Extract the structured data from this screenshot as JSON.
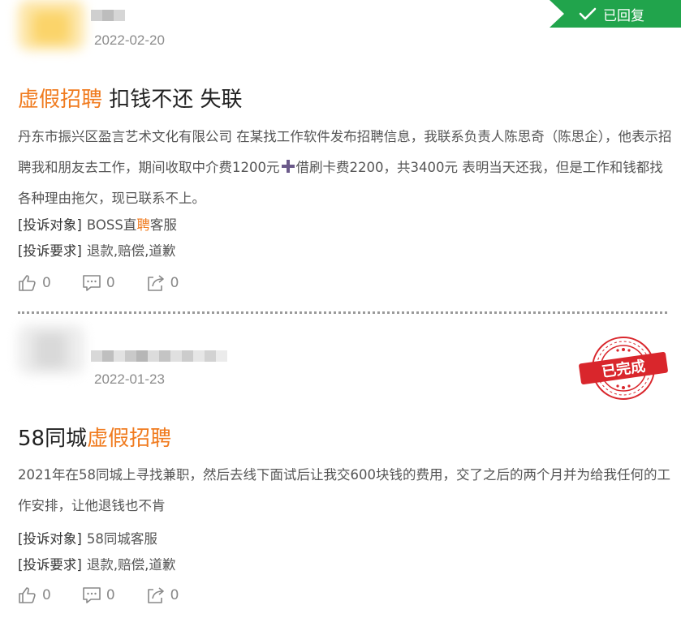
{
  "complaints": [
    {
      "date": "2022-02-20",
      "status_badge": "已回复",
      "title_highlight": "虚假招聘",
      "title_rest": " 扣钱不还 失联",
      "desc_part1": "丹东市振兴区盈言艺术文化有限公司 在某找工作软件发布招聘信息，我联系负责人陈思奇（陈思企），他表示招聘我和朋友去工作，期间收取中介费1200元",
      "desc_part2": "借刷卡费2200，共3400元 表明当天还我，但是工作和钱都找各种理由拖欠，现已联系不上。",
      "target_label": "[投诉对象]",
      "target_pre": "BOSS直",
      "target_hl": "聘",
      "target_post": "客服",
      "demand_label": "[投诉要求]",
      "demand_value": "退款,赔偿,道歉",
      "likes": "0",
      "comments": "0",
      "shares": "0"
    },
    {
      "date": "2022-01-23",
      "status_stamp": "已完成",
      "title_prefix": "58同城",
      "title_highlight": "虚假招聘",
      "desc": "2021年在58同城上寻找兼职，然后去线下面试后让我交600块钱的费用，交了之后的两个月并为给我任何的工作安排，让他退钱也不肯",
      "target_label": "[投诉对象]",
      "target_value": "58同城客服",
      "demand_label": "[投诉要求]",
      "demand_value": "退款,赔偿,道歉",
      "likes": "0",
      "comments": "0",
      "shares": "0"
    }
  ],
  "colors": {
    "highlight": "#f07b1f",
    "replied_badge": "#21a44c",
    "stamp_red": "#d9262c",
    "divider": "#9a9a9a"
  },
  "icons": [
    "avatar",
    "check-icon",
    "plus-icon",
    "thumbs-up-icon",
    "comment-icon",
    "share-icon",
    "completed-stamp"
  ]
}
